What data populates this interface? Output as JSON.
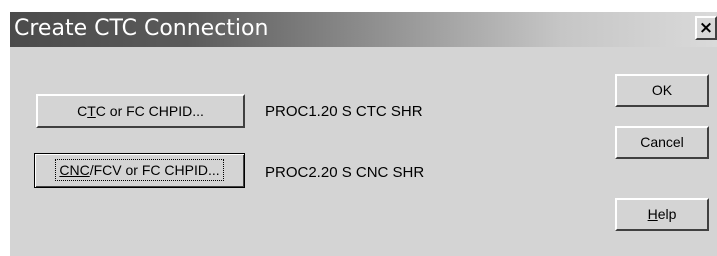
{
  "window": {
    "title": "Create CTC Connection",
    "close_glyph": "×"
  },
  "connections": [
    {
      "button": {
        "pre": "C",
        "mnemonic": "T",
        "post": "C or FC CHPID..."
      },
      "value": "PROC1.20 S CTC SHR"
    },
    {
      "button": {
        "pre": "",
        "mnemonic": "CNC",
        "post": "/FCV or FC CHPID..."
      },
      "value": "PROC2.20 S CNC SHR"
    }
  ],
  "actions": {
    "ok_label": "OK",
    "cancel_label": "Cancel",
    "help": {
      "mnemonic": "H",
      "rest": "elp"
    }
  },
  "colors": {
    "dialog_bg": "#d4d4d4",
    "title_text": "#ffffff",
    "titlebar_start": "#4b4b4b",
    "titlebar_end": "#dadada"
  }
}
